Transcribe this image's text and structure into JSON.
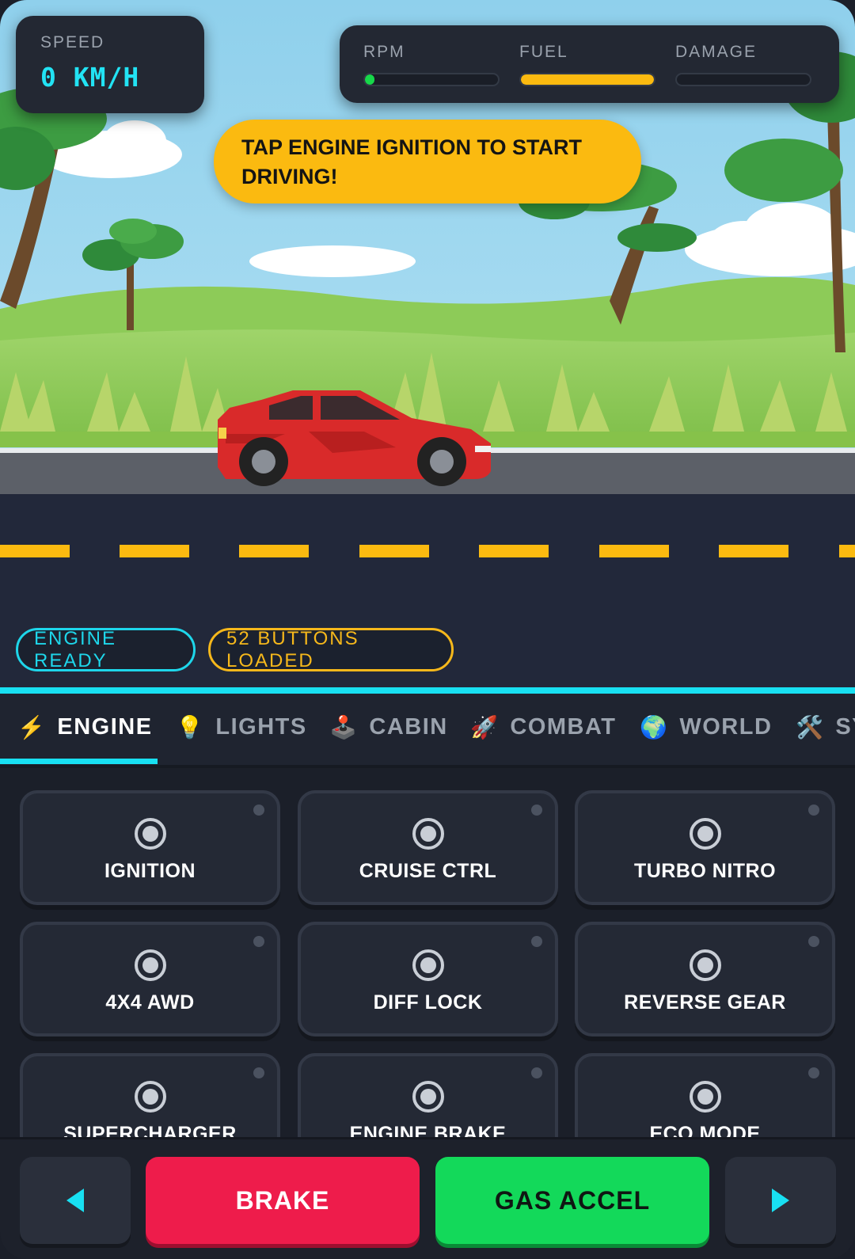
{
  "hud": {
    "speed_label": "SPEED",
    "speed_value": "0 KM/H",
    "stats": [
      {
        "label": "RPM",
        "level": 0.05,
        "color": "#17d84a"
      },
      {
        "label": "FUEL",
        "level": 1.0,
        "color": "#fbba10"
      },
      {
        "label": "DAMAGE",
        "level": 0.0,
        "color": "#e0344f"
      }
    ],
    "hint": "TAP ENGINE IGNITION TO START DRIVING!"
  },
  "status": {
    "engine": "ENGINE READY",
    "buttons_loaded": "52 BUTTONS LOADED"
  },
  "tabs": [
    {
      "icon": "⚡",
      "label": "ENGINE",
      "active": true
    },
    {
      "icon": "💡",
      "label": "LIGHTS"
    },
    {
      "icon": "🕹️",
      "label": "CABIN"
    },
    {
      "icon": "🚀",
      "label": "COMBAT"
    },
    {
      "icon": "🌍",
      "label": "WORLD"
    },
    {
      "icon": "🛠️",
      "label": "SY"
    }
  ],
  "controls": [
    {
      "label": "IGNITION"
    },
    {
      "label": "CRUISE CTRL"
    },
    {
      "label": "TURBO NITRO"
    },
    {
      "label": "4X4 AWD"
    },
    {
      "label": "DIFF LOCK"
    },
    {
      "label": "REVERSE GEAR"
    },
    {
      "label": "SUPERCHARGER"
    },
    {
      "label": "ENGINE BRAKE"
    },
    {
      "label": "ECO MODE"
    }
  ],
  "actions": {
    "brake": "BRAKE",
    "gas": "GAS ACCEL"
  },
  "colors": {
    "accent": "#18e0f2",
    "warning": "#fbba10",
    "brake": "#ee1c4b",
    "gas": "#13d95a",
    "car": "#d92a2a"
  }
}
